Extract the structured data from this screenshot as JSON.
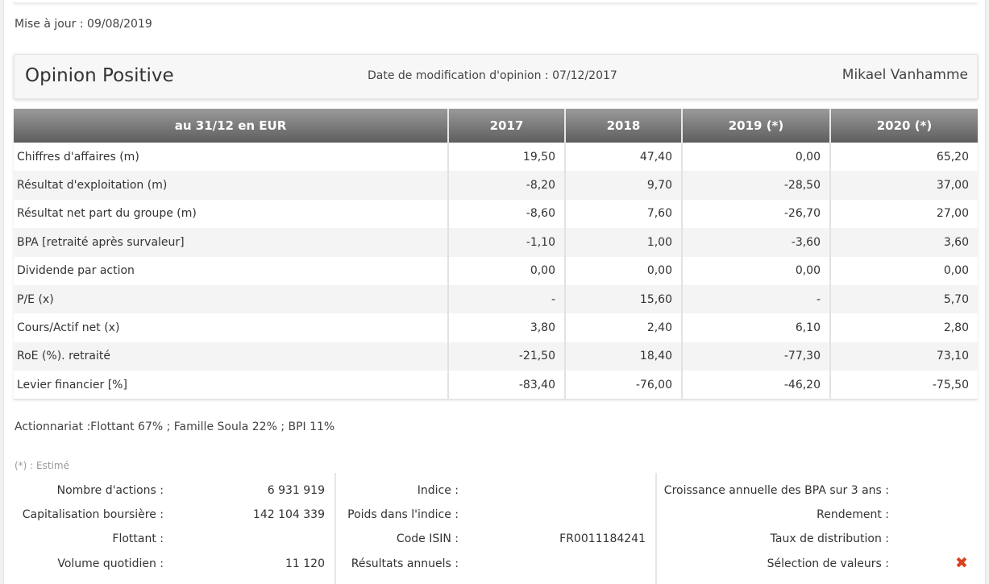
{
  "update": "Mise à jour : 09/08/2019",
  "opinion": {
    "title": "Opinion Positive",
    "date_line": "Date de modification d'opinion : 07/12/2017",
    "analyst": "Mikael Vanhamme"
  },
  "table": {
    "headers": [
      "au 31/12 en EUR",
      "2017",
      "2018",
      "2019 (*)",
      "2020 (*)"
    ],
    "rows": [
      {
        "label": "Chiffres d'affaires (m)",
        "values": [
          "19,50",
          "47,40",
          "0,00",
          "65,20"
        ]
      },
      {
        "label": "Résultat d'exploitation (m)",
        "values": [
          "-8,20",
          "9,70",
          "-28,50",
          "37,00"
        ]
      },
      {
        "label": "Résultat net part du groupe (m)",
        "values": [
          "-8,60",
          "7,60",
          "-26,70",
          "27,00"
        ]
      },
      {
        "label": "BPA [retraité après survaleur]",
        "values": [
          "-1,10",
          "1,00",
          "-3,60",
          "3,60"
        ]
      },
      {
        "label": "Dividende par action",
        "values": [
          "0,00",
          "0,00",
          "0,00",
          "0,00"
        ]
      },
      {
        "label": "P/E (x)",
        "values": [
          "-",
          "15,60",
          "-",
          "5,70"
        ]
      },
      {
        "label": "Cours/Actif net (x)",
        "values": [
          "3,80",
          "2,40",
          "6,10",
          "2,80"
        ]
      },
      {
        "label": "RoE (%). retraité",
        "values": [
          "-21,50",
          "18,40",
          "-77,30",
          "73,10"
        ]
      },
      {
        "label": "Levier financier [%]",
        "values": [
          "-83,40",
          "-76,00",
          "-46,20",
          "-75,50"
        ]
      }
    ]
  },
  "shareholders": "Actionnariat :Flottant 67% ; Famille Soula 22% ; BPI 11%",
  "estimate_note": "(*) : Estimé",
  "info": {
    "col1": [
      {
        "label": "Nombre d'actions :",
        "value": "6 931 919"
      },
      {
        "label": "Capitalisation boursière :",
        "value": "142 104 339"
      },
      {
        "label": "Flottant :",
        "value": ""
      },
      {
        "label": "Volume quotidien :",
        "value": "11 120"
      }
    ],
    "col2": [
      {
        "label": "Indice    :",
        "value": ""
      },
      {
        "label": "Poids dans l'indice :",
        "value": ""
      },
      {
        "label": "Code ISIN :",
        "value": "FR0011184241"
      },
      {
        "label": "Résultats annuels   :",
        "value": ""
      }
    ],
    "col3": [
      {
        "label": "Croissance annuelle des BPA sur 3 ans :",
        "value": ""
      },
      {
        "label": "Rendement   :",
        "value": ""
      },
      {
        "label": "Taux de distribution   :",
        "value": ""
      },
      {
        "label": "Sélection de valeurs :",
        "value": ""
      }
    ]
  },
  "icons": {
    "selection_status": "close-x-icon",
    "accent": "#d9411e"
  }
}
